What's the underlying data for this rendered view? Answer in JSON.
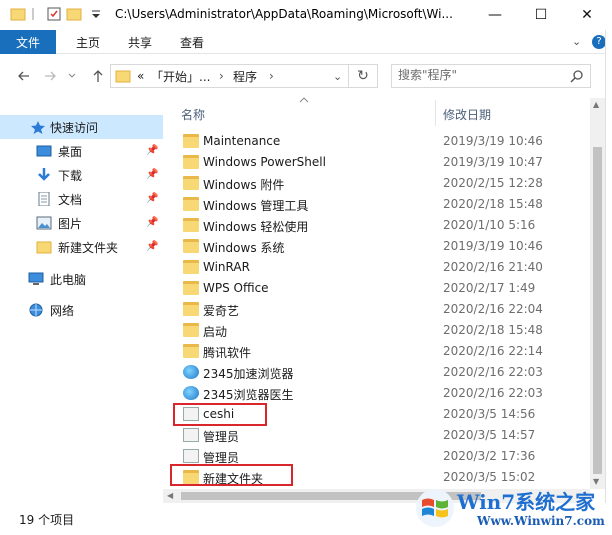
{
  "window": {
    "title": "C:\\Users\\Administrator\\AppData\\Roaming\\Microsoft\\Wi...",
    "minimize": "—",
    "maximize": "☐",
    "close": "✕"
  },
  "ribbon": {
    "file": "文件",
    "tabs": [
      "主页",
      "共享",
      "查看"
    ],
    "collapse": "⌄",
    "help": "?"
  },
  "address": {
    "overflow": "«",
    "crumbs": [
      "「开始」...",
      "程序"
    ],
    "separators": [
      "›",
      "›"
    ],
    "dropdown": "⌄",
    "refresh": "↻"
  },
  "search": {
    "placeholder": "搜索\"程序\"",
    "icon": "search-icon"
  },
  "navpane": {
    "quick_access": "快速访问",
    "items": [
      {
        "label": "桌面",
        "icon": "desktop-icon",
        "pinned": true
      },
      {
        "label": "下载",
        "icon": "download-icon",
        "pinned": true
      },
      {
        "label": "文档",
        "icon": "document-icon",
        "pinned": true
      },
      {
        "label": "图片",
        "icon": "pictures-icon",
        "pinned": true
      },
      {
        "label": "新建文件夹",
        "icon": "folder-icon",
        "pinned": true
      }
    ],
    "this_pc": "此电脑",
    "network": "网络"
  },
  "columns": {
    "name": "名称",
    "date": "修改日期"
  },
  "files": [
    {
      "name": "Maintenance",
      "date": "2019/3/19 10:46",
      "icon": "folder-icon"
    },
    {
      "name": "Windows PowerShell",
      "date": "2019/3/19 10:47",
      "icon": "folder-icon"
    },
    {
      "name": "Windows 附件",
      "date": "2020/2/15 12:28",
      "icon": "folder-icon"
    },
    {
      "name": "Windows 管理工具",
      "date": "2020/2/18 15:48",
      "icon": "folder-icon"
    },
    {
      "name": "Windows 轻松使用",
      "date": "2020/1/10 5:16",
      "icon": "folder-icon"
    },
    {
      "name": "Windows 系统",
      "date": "2019/3/19 10:46",
      "icon": "folder-icon"
    },
    {
      "name": "WinRAR",
      "date": "2020/2/16 21:40",
      "icon": "folder-icon"
    },
    {
      "name": "WPS Office",
      "date": "2020/2/17 1:49",
      "icon": "folder-icon"
    },
    {
      "name": "爱奇艺",
      "date": "2020/2/16 22:04",
      "icon": "folder-icon"
    },
    {
      "name": "启动",
      "date": "2020/2/18 15:48",
      "icon": "folder-icon"
    },
    {
      "name": "腾讯软件",
      "date": "2020/2/16 22:14",
      "icon": "folder-icon"
    },
    {
      "name": "2345加速浏览器",
      "date": "2020/2/16 22:03",
      "icon": "browser-shortcut-icon"
    },
    {
      "name": "2345浏览器医生",
      "date": "2020/2/16 22:03",
      "icon": "browser-shortcut-icon"
    },
    {
      "name": "ceshi",
      "date": "2020/3/5 14:56",
      "icon": "shortcut-icon"
    },
    {
      "name": "管理员",
      "date": "2020/3/5 14:57",
      "icon": "shortcut-icon"
    },
    {
      "name": "管理员",
      "date": "2020/3/2 17:36",
      "icon": "shortcut-icon"
    },
    {
      "name": "新建文件夹",
      "date": "2020/3/5 15:02",
      "icon": "folder-shortcut-icon"
    }
  ],
  "status": {
    "count": "19 个项目"
  },
  "watermark": {
    "title": "Win7系统之家",
    "url": "Www.Winwin7.com"
  },
  "colors": {
    "accent": "#1a6fbd",
    "selection": "#cce8ff",
    "highlight": "#d9262c",
    "folder": "#f8d775"
  }
}
